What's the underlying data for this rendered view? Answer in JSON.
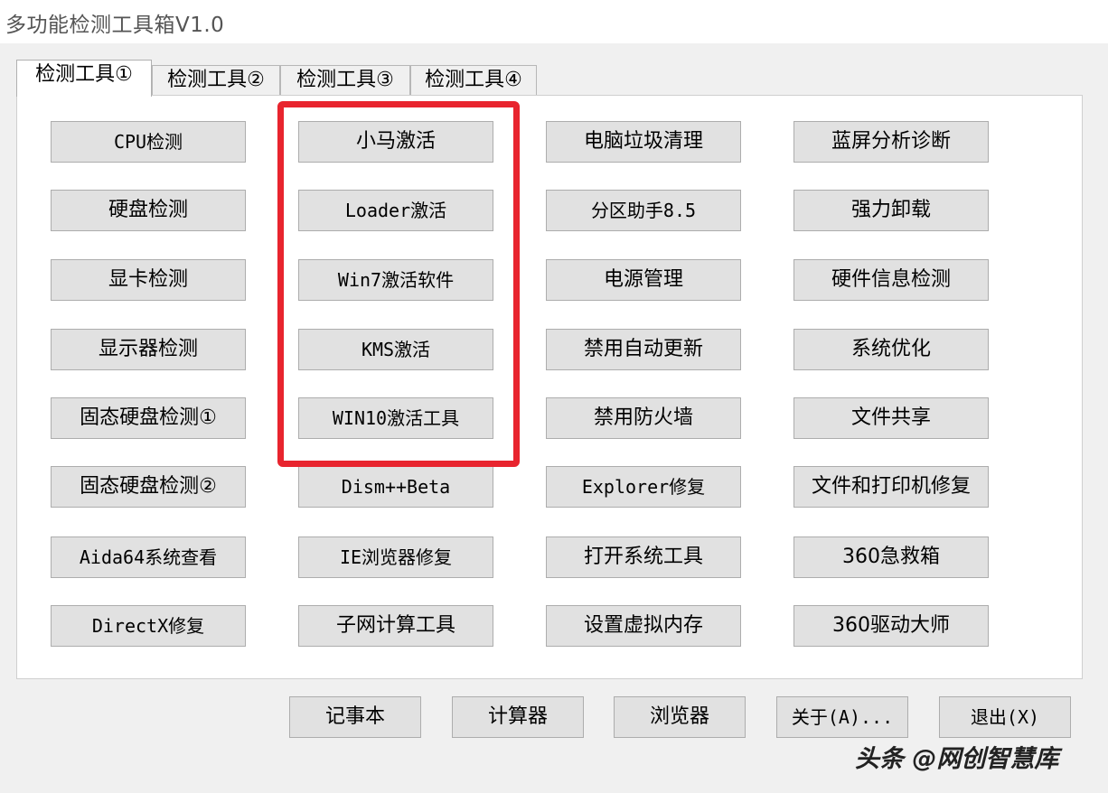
{
  "window": {
    "title": "多功能检测工具箱V1.0"
  },
  "tabs": [
    {
      "label": "检测工具①",
      "active": true
    },
    {
      "label": "检测工具②",
      "active": false
    },
    {
      "label": "检测工具③",
      "active": false
    },
    {
      "label": "检测工具④",
      "active": false
    }
  ],
  "columns": [
    [
      "CPU检测",
      "硬盘检测",
      "显卡检测",
      "显示器检测",
      "固态硬盘检测①",
      "固态硬盘检测②",
      "Aida64系统查看",
      "DirectX修复"
    ],
    [
      "小马激活",
      "Loader激活",
      "Win7激活软件",
      "KMS激活",
      "WIN10激活工具",
      "Dism++Beta",
      "IE浏览器修复",
      "子网计算工具"
    ],
    [
      "电脑垃圾清理",
      "分区助手8.5",
      "电源管理",
      "禁用自动更新",
      "禁用防火墙",
      "Explorer修复",
      "打开系统工具",
      "设置虚拟内存"
    ],
    [
      "蓝屏分析诊断",
      "强力卸载",
      "硬件信息检测",
      "系统优化",
      "文件共享",
      "文件和打印机修复",
      "360急救箱",
      "360驱动大师"
    ]
  ],
  "bottom_buttons": [
    "记事本",
    "计算器",
    "浏览器",
    "关于(A)...",
    "退出(X)"
  ],
  "highlight": {
    "color": "#e8242e"
  },
  "watermark": "头条 @网创智慧库"
}
